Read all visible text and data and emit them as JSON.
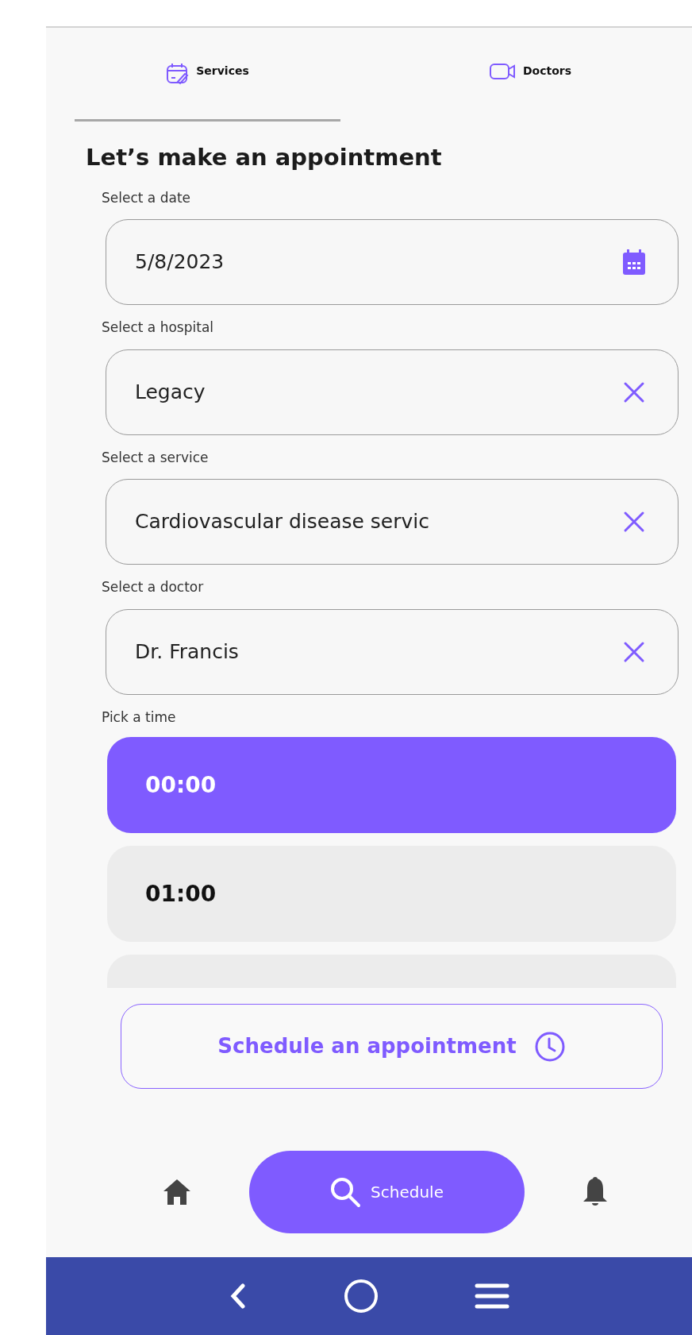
{
  "tabs": [
    {
      "label": "Services",
      "selected": true
    },
    {
      "label": "Doctors",
      "selected": false
    }
  ],
  "heading": "Let’s make an appointment",
  "fields": [
    {
      "label": "Select a date",
      "kind": "date",
      "value": "5/8/2023"
    },
    {
      "label": "Select a hospital",
      "kind": "clearable",
      "value": "Legacy"
    },
    {
      "label": "Select a service",
      "kind": "clearable",
      "value": "Cardiovascular disease servic"
    },
    {
      "label": "Select a doctor",
      "kind": "clearable",
      "value": "Dr. Francis"
    }
  ],
  "time_label": "Pick a time",
  "time_slots": [
    {
      "label": "00:00",
      "selected": true
    },
    {
      "label": "01:00",
      "selected": false
    }
  ],
  "more_slots_below": true,
  "schedule_button": "Schedule an appointment",
  "bottom_nav": [
    {
      "kind": "home",
      "selected": false
    },
    {
      "kind": "search",
      "label": "Schedule",
      "selected": true
    },
    {
      "kind": "bell",
      "selected": false
    }
  ]
}
